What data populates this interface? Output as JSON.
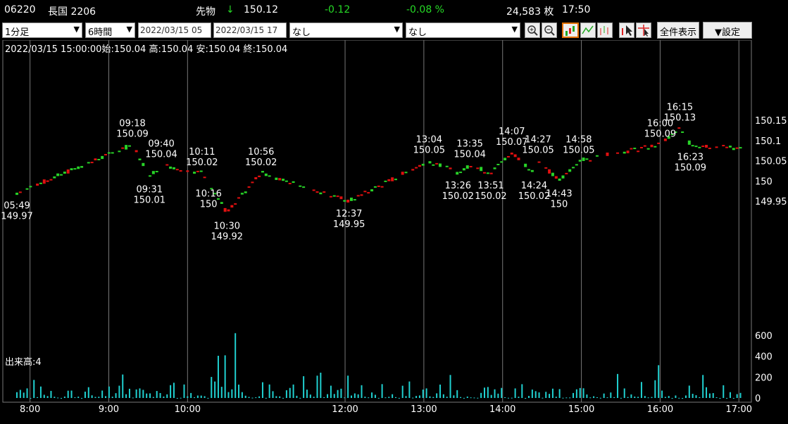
{
  "header": {
    "code": "06220",
    "name": "長国 2206",
    "market": "先物",
    "arrow": "↓",
    "price": "150.12",
    "change": "-0.12",
    "change_pct": "-0.08 %",
    "volume": "24,583 枚",
    "time": "17:50",
    "colors": {
      "down": "#26d926",
      "text": "#ffffff"
    }
  },
  "toolbar": {
    "interval": "1分足",
    "range": "6時間",
    "date_from": "2022/03/15 05",
    "date_to": "2022/03/15 17",
    "indicator1": "なし",
    "indicator2": "なし",
    "icons": [
      "zoom-in-icon",
      "zoom-out-icon",
      "candle-icon",
      "line-icon",
      "bar-icon",
      "cursor-icon",
      "crosshair-icon"
    ],
    "show_all": "全件表示",
    "settings": "▼設定"
  },
  "chart_data": {
    "type": "candlestick",
    "info_line": "2022/03/15 15:00:00始:150.04 高:150.04 安:150.04 終:150.04",
    "volume_label": "出来高:4",
    "price_ticks": [
      "150.15",
      "150.1",
      "150.05",
      "150",
      "149.95"
    ],
    "price_tick_values": [
      150.15,
      150.1,
      150.05,
      150,
      149.95
    ],
    "volume_ticks": [
      "600",
      "400",
      "200",
      "0"
    ],
    "volume_tick_values": [
      600,
      400,
      200,
      0
    ],
    "time_ticks": [
      "8:00",
      "9:00",
      "10:00",
      "12:00",
      "13:00",
      "14:00",
      "15:00",
      "16:00",
      "17:00"
    ],
    "time_tick_minutes": [
      480,
      540,
      600,
      720,
      780,
      840,
      900,
      960,
      1020
    ],
    "colors": {
      "up": "#e01010",
      "down": "#28d428",
      "volume": "#20d0d0",
      "grid": "#777777"
    },
    "annotations": [
      {
        "time": "05:49",
        "price": "149.97",
        "t": 470,
        "p": 149.97,
        "pos": "below"
      },
      {
        "time": "09:18",
        "price": "150.09",
        "t": 558,
        "p": 150.09,
        "pos": "above"
      },
      {
        "time": "09:40",
        "price": "150.04",
        "t": 580,
        "p": 150.04,
        "pos": "above"
      },
      {
        "time": "09:31",
        "price": "150.01",
        "t": 571,
        "p": 150.01,
        "pos": "below"
      },
      {
        "time": "10:11",
        "price": "150.02",
        "t": 611,
        "p": 150.02,
        "pos": "above"
      },
      {
        "time": "10:16",
        "price": "150",
        "t": 616,
        "p": 150.0,
        "pos": "below"
      },
      {
        "time": "10:30",
        "price": "149.92",
        "t": 630,
        "p": 149.92,
        "pos": "below"
      },
      {
        "time": "10:56",
        "price": "150.02",
        "t": 656,
        "p": 150.02,
        "pos": "above"
      },
      {
        "time": "12:37",
        "price": "149.95",
        "t": 723,
        "p": 149.95,
        "pos": "below"
      },
      {
        "time": "13:04",
        "price": "150.05",
        "t": 784,
        "p": 150.05,
        "pos": "above"
      },
      {
        "time": "13:26",
        "price": "150.02",
        "t": 806,
        "p": 150.02,
        "pos": "below"
      },
      {
        "time": "13:35",
        "price": "150.04",
        "t": 815,
        "p": 150.04,
        "pos": "above"
      },
      {
        "time": "13:51",
        "price": "150.02",
        "t": 831,
        "p": 150.02,
        "pos": "below"
      },
      {
        "time": "14:07",
        "price": "150.07",
        "t": 847,
        "p": 150.07,
        "pos": "above"
      },
      {
        "time": "14:24",
        "price": "150.02",
        "t": 864,
        "p": 150.02,
        "pos": "below"
      },
      {
        "time": "14:27",
        "price": "150.05",
        "t": 867,
        "p": 150.05,
        "pos": "above"
      },
      {
        "time": "14:43",
        "price": "150",
        "t": 883,
        "p": 150.0,
        "pos": "below"
      },
      {
        "time": "14:58",
        "price": "150.05",
        "t": 898,
        "p": 150.05,
        "pos": "above"
      },
      {
        "time": "16:00",
        "price": "150.09",
        "t": 960,
        "p": 150.09,
        "pos": "above"
      },
      {
        "time": "16:15",
        "price": "150.13",
        "t": 975,
        "p": 150.13,
        "pos": "above"
      },
      {
        "time": "16:23",
        "price": "150.09",
        "t": 983,
        "p": 150.09,
        "pos": "below"
      }
    ]
  }
}
